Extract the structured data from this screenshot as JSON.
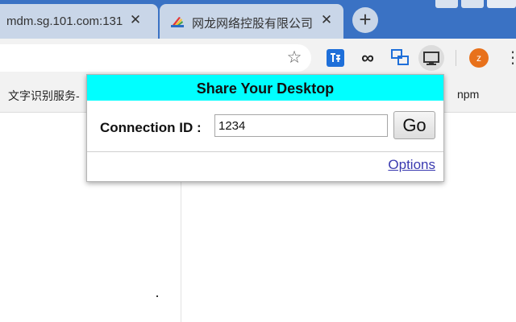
{
  "tabs": [
    {
      "title": "mdm.sg.101.com:131",
      "close_glyph": "✕",
      "active": false
    },
    {
      "title": "网龙网络控股有限公司",
      "close_glyph": "✕",
      "active": false,
      "favicon": "colorful-logo-icon"
    }
  ],
  "new_tab_glyph": "+",
  "toolbar": {
    "star_glyph": "☆",
    "infinity_glyph": "∞",
    "avatar_letter": "z",
    "menu_glyph": "⋮",
    "extension_icons": [
      "translate-icon",
      "infinity-icon",
      "screen-share-icon",
      "desktop-icon"
    ]
  },
  "bookmarks": [
    "文字识别服务-",
    "npm"
  ],
  "popup": {
    "title": "Share Your Desktop",
    "connection_label": "Connection ID :",
    "connection_value": "1234",
    "go_label": "Go",
    "options_label": "Options"
  },
  "colors": {
    "tab_strip": "#3a72c4",
    "popup_header": "#00ffff",
    "avatar": "#e8711b",
    "link": "#3a3ab0"
  }
}
